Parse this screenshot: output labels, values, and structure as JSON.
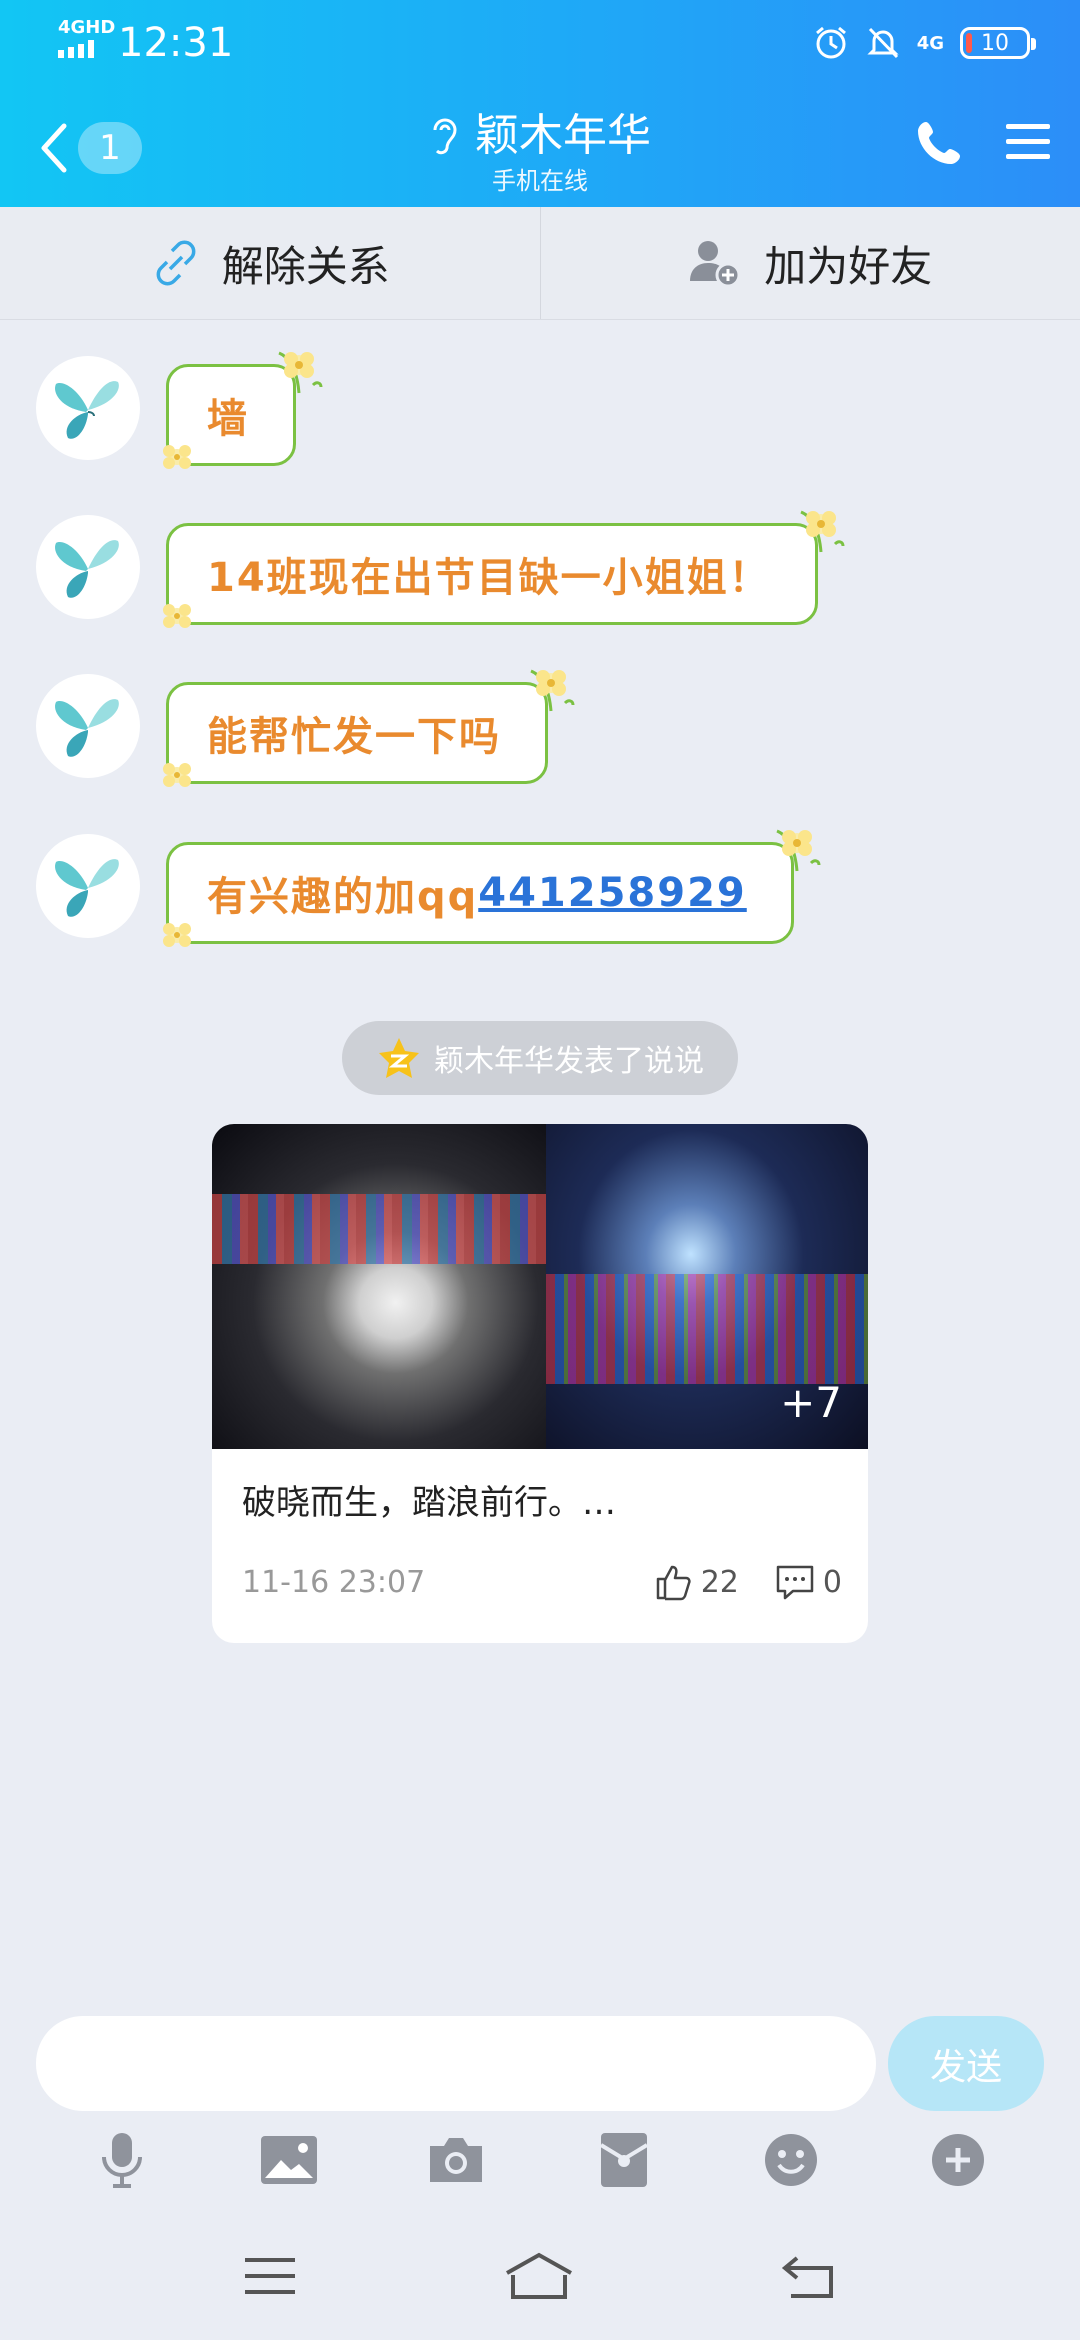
{
  "status_bar": {
    "network": "4GHD",
    "time": "12:31",
    "network_right": "4G",
    "battery": "10"
  },
  "nav": {
    "back_count": "1",
    "title": "颖木年华",
    "subtitle": "手机在线"
  },
  "actions": {
    "unlink_label": "解除关系",
    "add_friend_label": "加为好友"
  },
  "messages": [
    {
      "text": "墙"
    },
    {
      "text": "14班现在出节目缺一小姐姐！"
    },
    {
      "text": "能帮忙发一下吗"
    },
    {
      "text": "有兴趣的加qq",
      "link": "441258929"
    }
  ],
  "notice": {
    "text": "颖木年华发表了说说"
  },
  "post": {
    "more_photos": "+7",
    "text": "破晓而生，踏浪前行。…",
    "time": "11-16 23:07",
    "likes": "22",
    "comments": "0"
  },
  "composer": {
    "placeholder": "",
    "send_label": "发送"
  },
  "colors": {
    "header_start": "#12c6f4",
    "header_end": "#2c8ef8",
    "bubble_text": "#e98a2e",
    "bubble_border": "#7bc142",
    "link": "#2a73d8"
  }
}
